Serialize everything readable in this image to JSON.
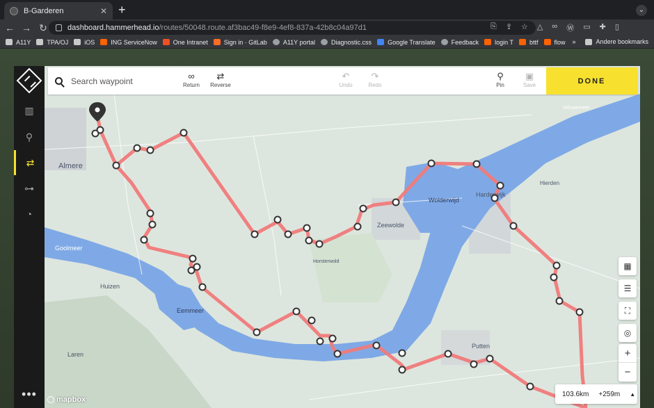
{
  "browser": {
    "tab_title": "B-Garderen",
    "url_host": "dashboard.hammerhead.io",
    "url_path": "/routes/50048.route.af3bac49-f8e9-4ef8-837a-42b8c04a97d1"
  },
  "bookmarks": [
    {
      "label": "A11Y",
      "icon": "folder-icon",
      "color": "#c9c9c9"
    },
    {
      "label": "TPA/OJ",
      "icon": "folder-icon",
      "color": "#c9c9c9"
    },
    {
      "label": "iOS",
      "icon": "folder-icon",
      "color": "#c9c9c9"
    },
    {
      "label": "ING ServiceNow",
      "icon": "ing-icon",
      "color": "#ff6200"
    },
    {
      "label": "One Intranet",
      "icon": "windows-icon",
      "color": "#f25022"
    },
    {
      "label": "Sign in · GitLab",
      "icon": "gitlab-icon",
      "color": "#fc6d26"
    },
    {
      "label": "A11Y portal",
      "icon": "globe-icon",
      "color": "#9aa0a6"
    },
    {
      "label": "Diagnostic.css",
      "icon": "globe-icon",
      "color": "#9aa0a6"
    },
    {
      "label": "Google Translate",
      "icon": "translate-icon",
      "color": "#4285f4"
    },
    {
      "label": "Feedback",
      "icon": "globe-icon",
      "color": "#9aa0a6"
    },
    {
      "label": "login T",
      "icon": "ing-icon",
      "color": "#ff6200"
    },
    {
      "label": "bttf",
      "icon": "ing-icon",
      "color": "#ff6200"
    },
    {
      "label": "flow",
      "icon": "ing-icon",
      "color": "#ff6200"
    }
  ],
  "bookmarks_other": "Andere bookmarks",
  "bookmarks_overflow": "»",
  "toolbar": {
    "search_placeholder": "Search waypoint",
    "return_label": "Return",
    "reverse_label": "Reverse",
    "undo_label": "Undo",
    "redo_label": "Redo",
    "pin_label": "Pin",
    "save_label": "Save",
    "done_label": "DONE"
  },
  "map": {
    "place_labels": [
      {
        "name": "Almere"
      },
      {
        "name": "Goolmeer"
      },
      {
        "name": "Huizen"
      },
      {
        "name": "Eemmeer"
      },
      {
        "name": "Laren"
      },
      {
        "name": "Horsterwold"
      },
      {
        "name": "Zeewolde"
      },
      {
        "name": "Wolderwijd"
      },
      {
        "name": "Harderwijk"
      },
      {
        "name": "Hierden"
      },
      {
        "name": "Veluwemeer"
      },
      {
        "name": "Putten"
      }
    ],
    "route_color": "#f07a7a",
    "water_color": "#7fa9e6"
  },
  "stats": {
    "distance": "103.6km",
    "elevation": "+259m"
  },
  "attribution": "mapbox"
}
